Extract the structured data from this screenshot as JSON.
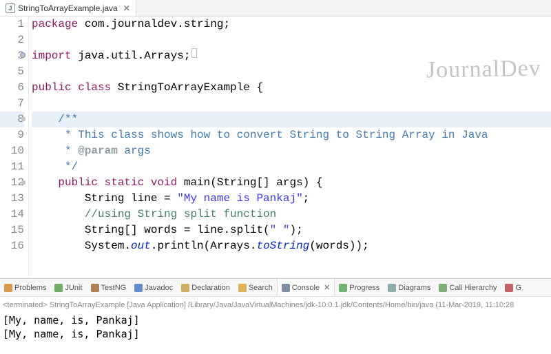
{
  "editorTab": {
    "filename": "StringToArrayExample.java"
  },
  "watermark": "JournalDev",
  "code": {
    "lines": [
      {
        "n": "1",
        "segs": [
          {
            "c": "kw",
            "t": "package"
          },
          {
            "c": "plain",
            "t": " com.journaldev.string;"
          }
        ]
      },
      {
        "n": "2",
        "segs": []
      },
      {
        "n": "3",
        "marker": "dot",
        "segs": [
          {
            "c": "kw",
            "t": "import"
          },
          {
            "c": "plain",
            "t": " java.util.Arrays;"
          },
          {
            "c": "box",
            "t": ""
          }
        ]
      },
      {
        "n": "5",
        "segs": []
      },
      {
        "n": "6",
        "segs": [
          {
            "c": "kw",
            "t": "public class"
          },
          {
            "c": "plain",
            "t": " StringToArrayExample {"
          }
        ]
      },
      {
        "n": "7",
        "segs": []
      },
      {
        "n": "8",
        "marker": "sm",
        "hl": true,
        "segs": [
          {
            "c": "plain",
            "t": "    "
          },
          {
            "c": "com",
            "t": "/**"
          }
        ]
      },
      {
        "n": "9",
        "segs": [
          {
            "c": "plain",
            "t": "     "
          },
          {
            "c": "com",
            "t": "* This class shows how to convert String to String Array in Java"
          }
        ]
      },
      {
        "n": "10",
        "segs": [
          {
            "c": "plain",
            "t": "     "
          },
          {
            "c": "com",
            "t": "* "
          },
          {
            "c": "tag",
            "t": "@param"
          },
          {
            "c": "com",
            "t": " args"
          }
        ]
      },
      {
        "n": "11",
        "segs": [
          {
            "c": "plain",
            "t": "     "
          },
          {
            "c": "com",
            "t": "*/"
          }
        ]
      },
      {
        "n": "12",
        "marker": "sm",
        "segs": [
          {
            "c": "plain",
            "t": "    "
          },
          {
            "c": "kw",
            "t": "public static void"
          },
          {
            "c": "plain",
            "t": " main(String[] args) {"
          }
        ]
      },
      {
        "n": "13",
        "segs": [
          {
            "c": "plain",
            "t": "        String line = "
          },
          {
            "c": "str",
            "t": "\"My name is Pankaj\""
          },
          {
            "c": "plain",
            "t": ";"
          }
        ]
      },
      {
        "n": "14",
        "segs": [
          {
            "c": "plain",
            "t": "        "
          },
          {
            "c": "comg",
            "t": "//using String split function"
          }
        ]
      },
      {
        "n": "15",
        "segs": [
          {
            "c": "plain",
            "t": "        String[] words = line.split("
          },
          {
            "c": "str",
            "t": "\" \""
          },
          {
            "c": "plain",
            "t": ");"
          }
        ]
      },
      {
        "n": "16",
        "segs": [
          {
            "c": "plain",
            "t": "        System."
          },
          {
            "c": "it",
            "t": "out"
          },
          {
            "c": "plain",
            "t": ".println(Arrays."
          },
          {
            "c": "it",
            "t": "toString"
          },
          {
            "c": "plain",
            "t": "(words));"
          }
        ]
      }
    ]
  },
  "viewTabs": [
    {
      "label": "Problems",
      "iconColor": "#d08a2f"
    },
    {
      "label": "JUnit",
      "iconColor": "#5b9e4d"
    },
    {
      "label": "TestNG",
      "iconColor": "#a06e3a"
    },
    {
      "label": "Javadoc",
      "iconColor": "#4a78c4"
    },
    {
      "label": "Declaration",
      "iconColor": "#c9a24a"
    },
    {
      "label": "Search",
      "iconColor": "#d6a93b"
    },
    {
      "label": "Console",
      "iconColor": "#6b7b8d",
      "active": true,
      "closable": true
    },
    {
      "label": "Progress",
      "iconColor": "#5aa55a"
    },
    {
      "label": "Diagrams",
      "iconColor": "#7aa0a0"
    },
    {
      "label": "Call Hierarchy",
      "iconColor": "#6aa060"
    },
    {
      "label": "G",
      "iconColor": "#b84a4a"
    }
  ],
  "console": {
    "meta": "<terminated> StringToArrayExample [Java Application] /Library/Java/JavaVirtualMachines/jdk-10.0.1.jdk/Contents/Home/bin/java (11-Mar-2019, 11:10:28",
    "out": [
      "[My, name, is, Pankaj]",
      "[My, name, is, Pankaj]"
    ]
  }
}
